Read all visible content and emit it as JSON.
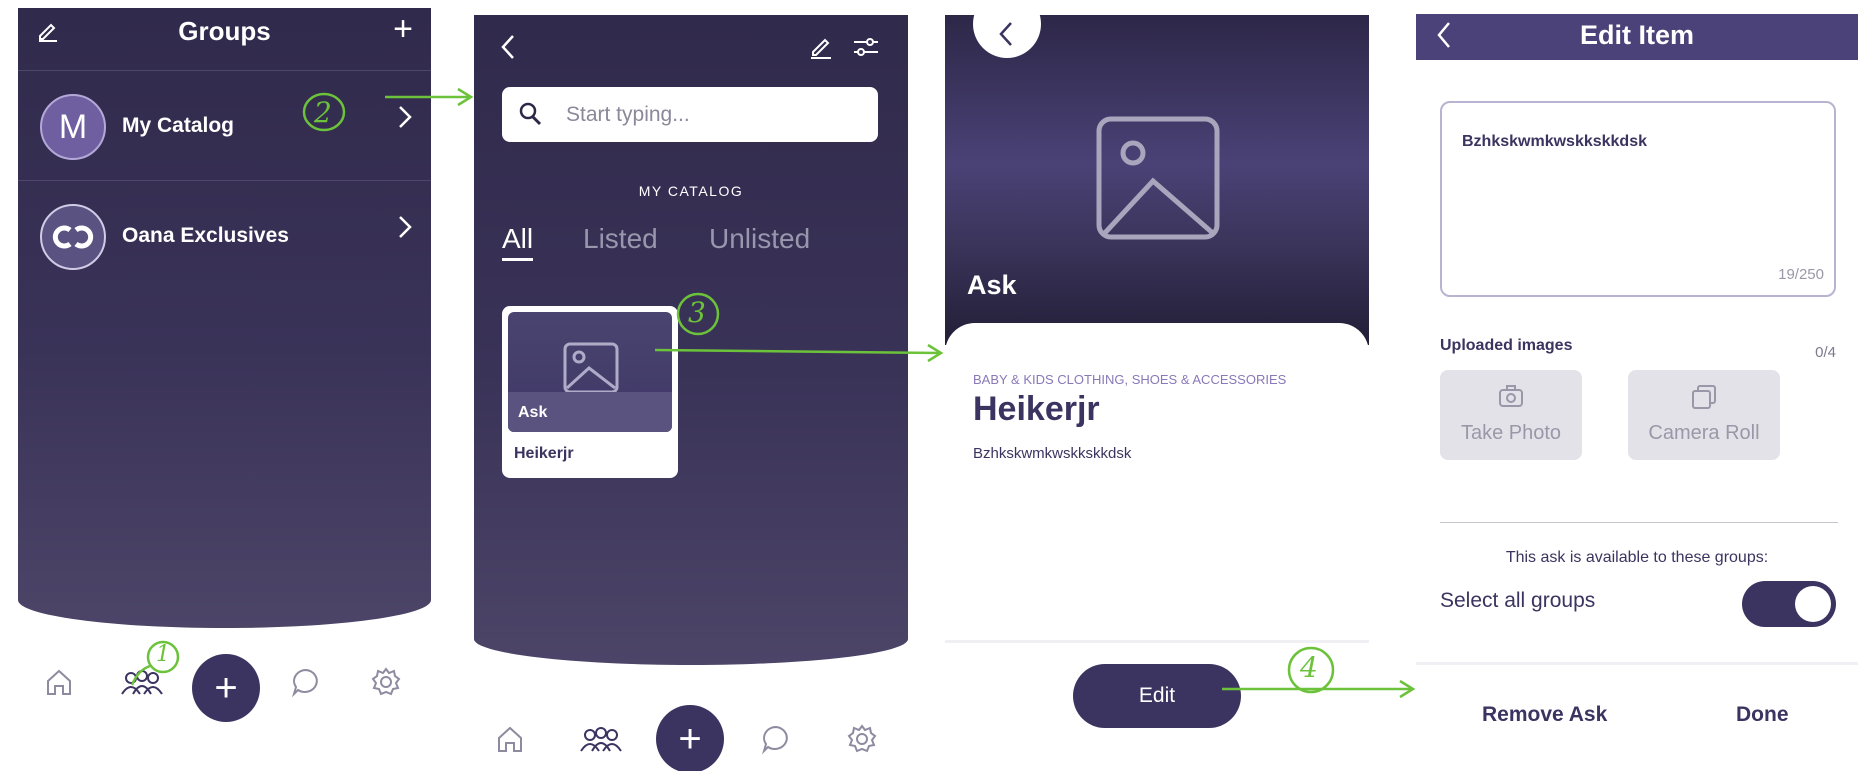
{
  "panel1": {
    "title": "Groups",
    "groups": [
      {
        "initial": "M",
        "name": "My Catalog",
        "avatar_color": "#6f5fa0"
      },
      {
        "initial": "",
        "name": "Oana Exclusives",
        "avatar_color": "#5a5280"
      }
    ]
  },
  "panel2": {
    "search_placeholder": "Start typing...",
    "catalog_label": "MY CATALOG",
    "tabs": [
      "All",
      "Listed",
      "Unlisted"
    ],
    "card": {
      "badge": "Ask",
      "name": "Heikerjr"
    }
  },
  "panel3": {
    "hero_label": "Ask",
    "category": "BABY & KIDS CLOTHING, SHOES & ACCESSORIES",
    "title": "Heikerjr",
    "description": "Bzhkskwmkwskkskkdsk",
    "edit_label": "Edit"
  },
  "panel4": {
    "title": "Edit Item",
    "description_value": "Bzhkskwmkwskkskkdsk",
    "char_count": "19/250",
    "uploaded_label": "Uploaded images",
    "uploaded_count": "0/4",
    "take_photo": "Take Photo",
    "camera_roll": "Camera Roll",
    "availability_text": "This ask is available to these groups:",
    "select_all": "Select all groups",
    "select_all_on": true,
    "remove_label": "Remove Ask",
    "done_label": "Done"
  },
  "annotations": [
    "1",
    "2",
    "3",
    "4"
  ],
  "colors": {
    "brand_dark": "#3b3460",
    "header_purple": "#4a4278",
    "annotation_green": "#6cc23a"
  }
}
